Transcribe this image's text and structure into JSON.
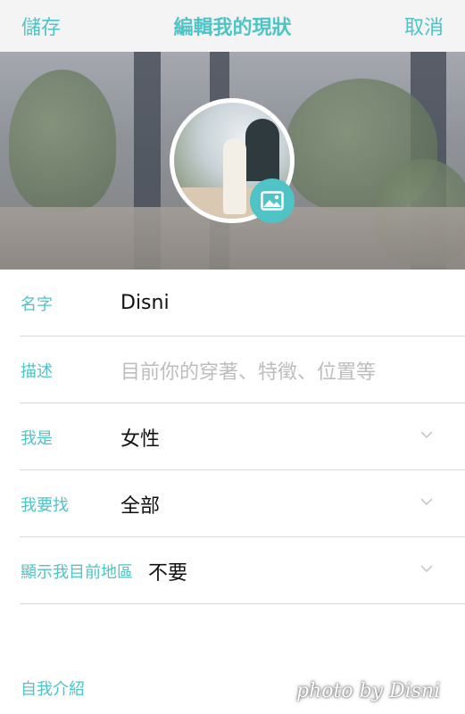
{
  "nav": {
    "save_label": "儲存",
    "title": "編輯我的現狀",
    "cancel_label": "取消"
  },
  "colors": {
    "accent": "#4fc3c6",
    "divider": "#d8d8d8",
    "placeholder": "#bdbdbd"
  },
  "form": {
    "name": {
      "label": "名字",
      "value": "Disni"
    },
    "description": {
      "label": "描述",
      "placeholder": "目前你的穿著、特徵、位置等"
    },
    "gender": {
      "label": "我是",
      "value": "女性",
      "icon": "chevron-down-icon"
    },
    "looking_for": {
      "label": "我要找",
      "value": "全部",
      "icon": "chevron-down-icon"
    },
    "show_region": {
      "label": "顯示我目前地區",
      "value": "不要",
      "icon": "chevron-down-icon"
    }
  },
  "intro": {
    "label": "自我介紹"
  },
  "watermark": "photo by Disni"
}
